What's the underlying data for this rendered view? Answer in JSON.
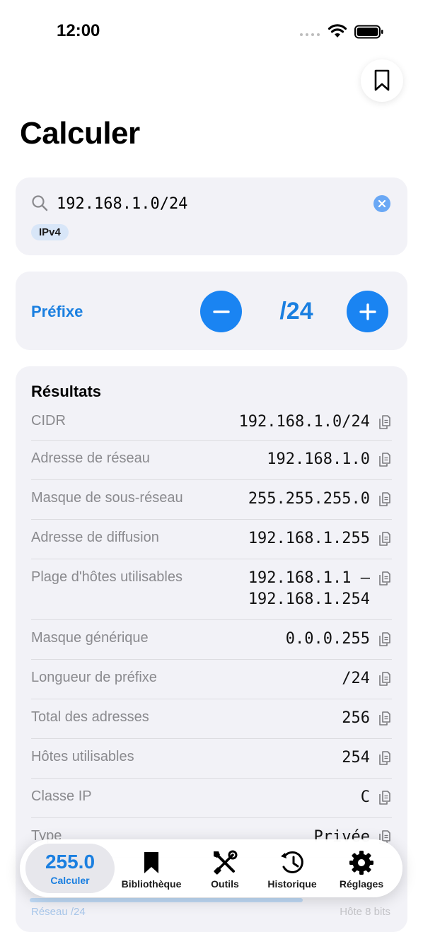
{
  "status_bar": {
    "time": "12:00"
  },
  "page": {
    "title": "Calculer"
  },
  "search": {
    "value": "192.168.1.0/24",
    "badge": "IPv4"
  },
  "prefix": {
    "label": "Préfixe",
    "value": "/24"
  },
  "results": {
    "title": "Résultats",
    "rows": [
      {
        "label": "CIDR",
        "value": "192.168.1.0/24"
      },
      {
        "label": "Adresse de réseau",
        "value": "192.168.1.0"
      },
      {
        "label": "Masque de sous-réseau",
        "value": "255.255.255.0"
      },
      {
        "label": "Adresse de diffusion",
        "value": "192.168.1.255"
      },
      {
        "label": "Plage d'hôtes utilisables",
        "value": "192.168.1.1 —\n192.168.1.254"
      },
      {
        "label": "Masque générique",
        "value": "0.0.0.255"
      },
      {
        "label": "Longueur de préfixe",
        "value": "/24"
      },
      {
        "label": "Total des adresses",
        "value": "256"
      },
      {
        "label": "Hôtes utilisables",
        "value": "254"
      },
      {
        "label": "Classe IP",
        "value": "C"
      },
      {
        "label": "Type",
        "value": "Privée"
      }
    ],
    "footer_left": "Réseau /24",
    "footer_right": "Hôte 8 bits"
  },
  "tab_bar": {
    "active_value": "255.0",
    "tabs": [
      {
        "label": "Calculer",
        "icon": "calculator-icon",
        "active": true
      },
      {
        "label": "Bibliothèque",
        "icon": "bookmark-icon"
      },
      {
        "label": "Outils",
        "icon": "tools-icon"
      },
      {
        "label": "Historique",
        "icon": "history-icon"
      },
      {
        "label": "Réglages",
        "icon": "gear-icon"
      }
    ]
  },
  "colors": {
    "accent": "#1a84f2",
    "card_bg": "#f2f2f7",
    "label_gray": "#8a8a8e"
  }
}
